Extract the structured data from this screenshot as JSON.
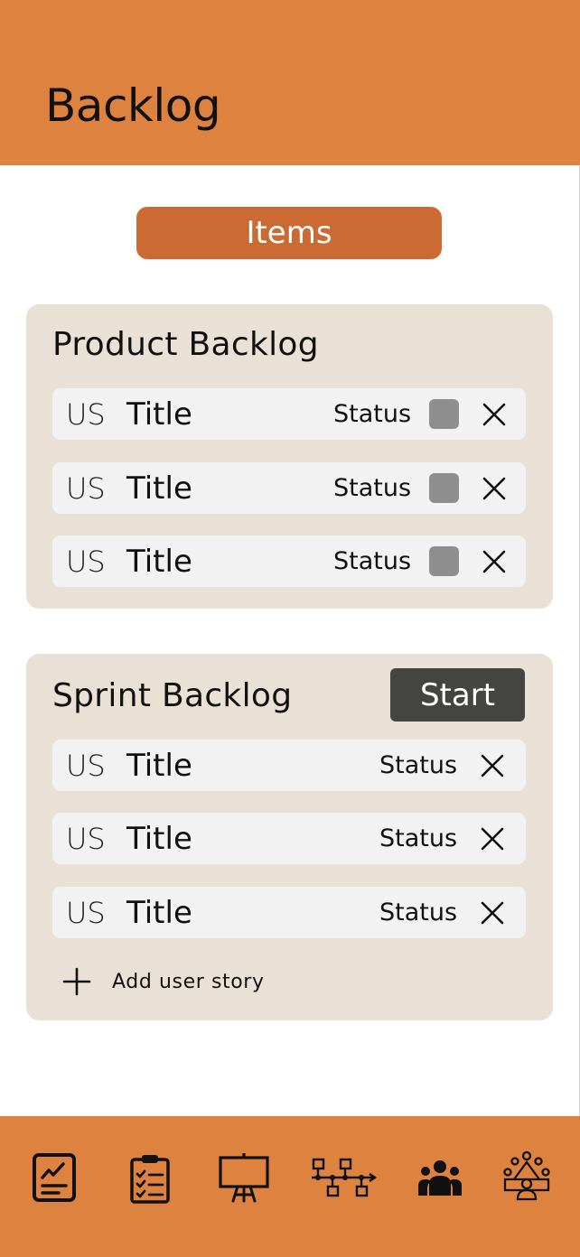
{
  "header": {
    "title": "Backlog",
    "background": "#de823f"
  },
  "items_button": {
    "label": "Items",
    "color": "#cc6a33"
  },
  "product_backlog": {
    "title": "Product Backlog",
    "rows": [
      {
        "id_label": "US",
        "title": "Title",
        "status": "Status",
        "checked": false
      },
      {
        "id_label": "US",
        "title": "Title",
        "status": "Status",
        "checked": false
      },
      {
        "id_label": "US",
        "title": "Title",
        "status": "Status",
        "checked": false
      }
    ]
  },
  "sprint_backlog": {
    "title": "Sprint Backlog",
    "start_label": "Start",
    "rows": [
      {
        "id_label": "US",
        "title": "Title",
        "status": "Status"
      },
      {
        "id_label": "US",
        "title": "Title",
        "status": "Status"
      },
      {
        "id_label": "US",
        "title": "Title",
        "status": "Status"
      }
    ],
    "add_label": "Add user story"
  },
  "bottom_nav": {
    "background": "#de823f",
    "items": [
      {
        "icon": "report-chart-icon"
      },
      {
        "icon": "clipboard-checklist-icon"
      },
      {
        "icon": "presentation-easel-icon"
      },
      {
        "icon": "workflow-diagram-icon"
      },
      {
        "icon": "team-group-icon"
      },
      {
        "icon": "meeting-table-icon"
      }
    ]
  },
  "colors": {
    "panel": "#e9e1d6",
    "row": "#f2f2f3",
    "checkbox": "#8e8e8e",
    "start_button": "#444541"
  }
}
